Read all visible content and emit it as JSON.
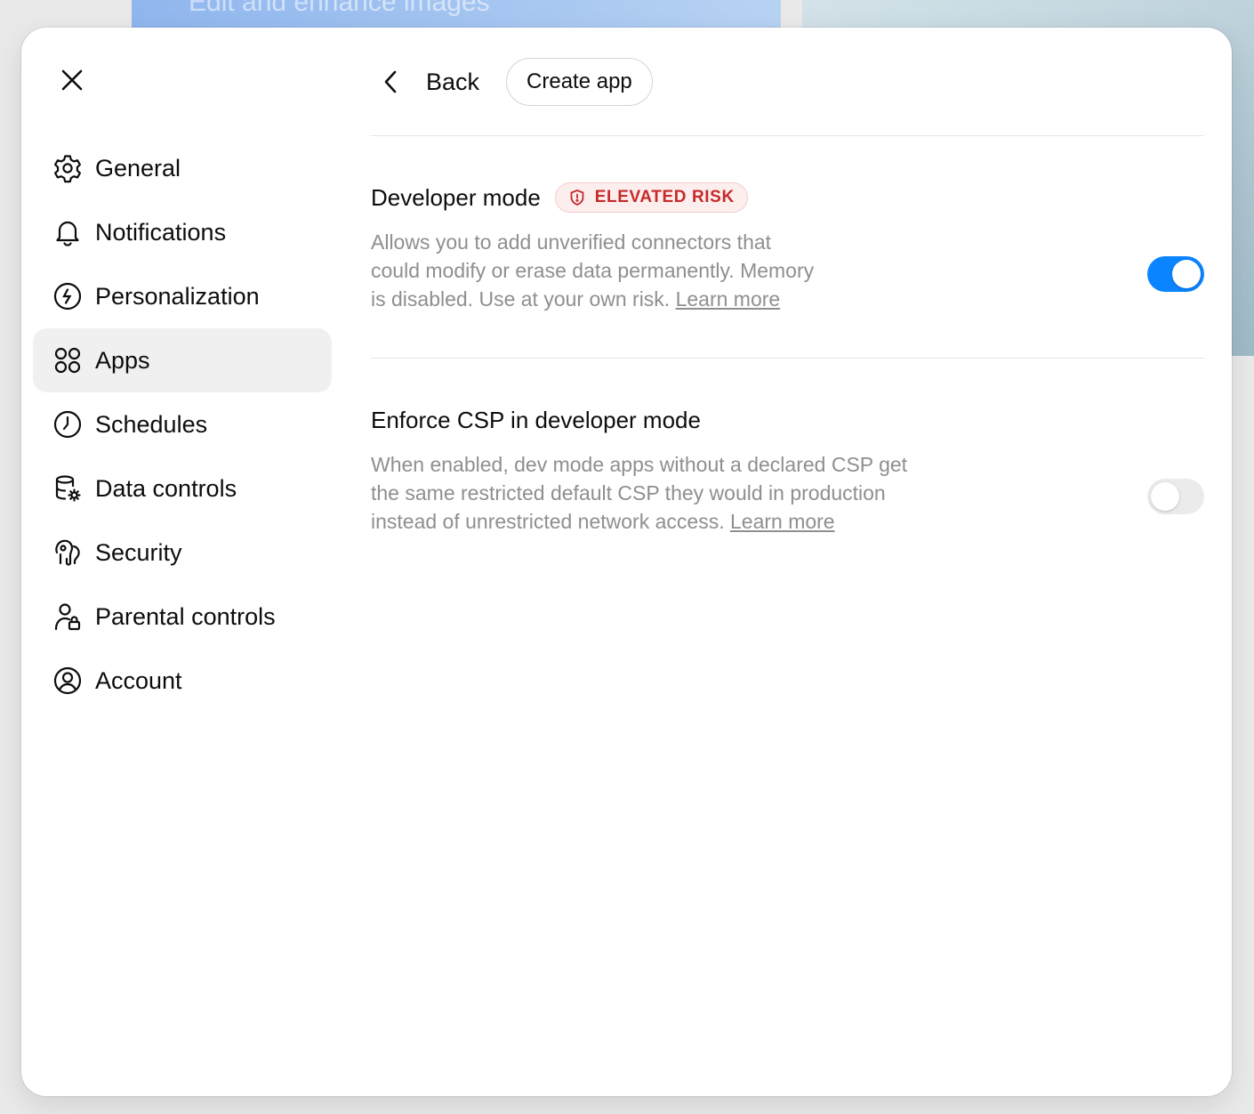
{
  "background": {
    "card_text": "Edit and enhance images"
  },
  "colors": {
    "accent": "#0a84ff",
    "risk_red": "#c62a2a",
    "active_bg": "#f0f0f1",
    "muted_text": "#8f8f8f"
  },
  "sidebar": {
    "items": [
      {
        "label": "General",
        "icon": "gear-icon",
        "active": false
      },
      {
        "label": "Notifications",
        "icon": "bell-icon",
        "active": false
      },
      {
        "label": "Personalization",
        "icon": "personalization-icon",
        "active": false
      },
      {
        "label": "Apps",
        "icon": "apps-grid-icon",
        "active": true
      },
      {
        "label": "Schedules",
        "icon": "clock-icon",
        "active": false
      },
      {
        "label": "Data controls",
        "icon": "database-gear-icon",
        "active": false
      },
      {
        "label": "Security",
        "icon": "security-key-icon",
        "active": false
      },
      {
        "label": "Parental controls",
        "icon": "person-lock-icon",
        "active": false
      },
      {
        "label": "Account",
        "icon": "user-circle-icon",
        "active": false
      }
    ]
  },
  "toolbar": {
    "back_label": "Back",
    "create_label": "Create app"
  },
  "settings": {
    "developer_mode": {
      "title": "Developer mode",
      "badge": "ELEVATED RISK",
      "description_line1": "Allows you to add unverified connectors that",
      "description_line2": "could modify or erase data permanently. Memory",
      "description_line3": "is disabled. Use at your own risk. ",
      "link": "Learn more",
      "enabled": true
    },
    "enforce_csp": {
      "title": "Enforce CSP in developer mode",
      "description_line1": "When enabled, dev mode apps without a declared CSP get",
      "description_line2": "the same restricted default CSP they would in production",
      "description_line3": "instead of unrestricted network access. ",
      "link": "Learn more",
      "enabled": false
    }
  }
}
